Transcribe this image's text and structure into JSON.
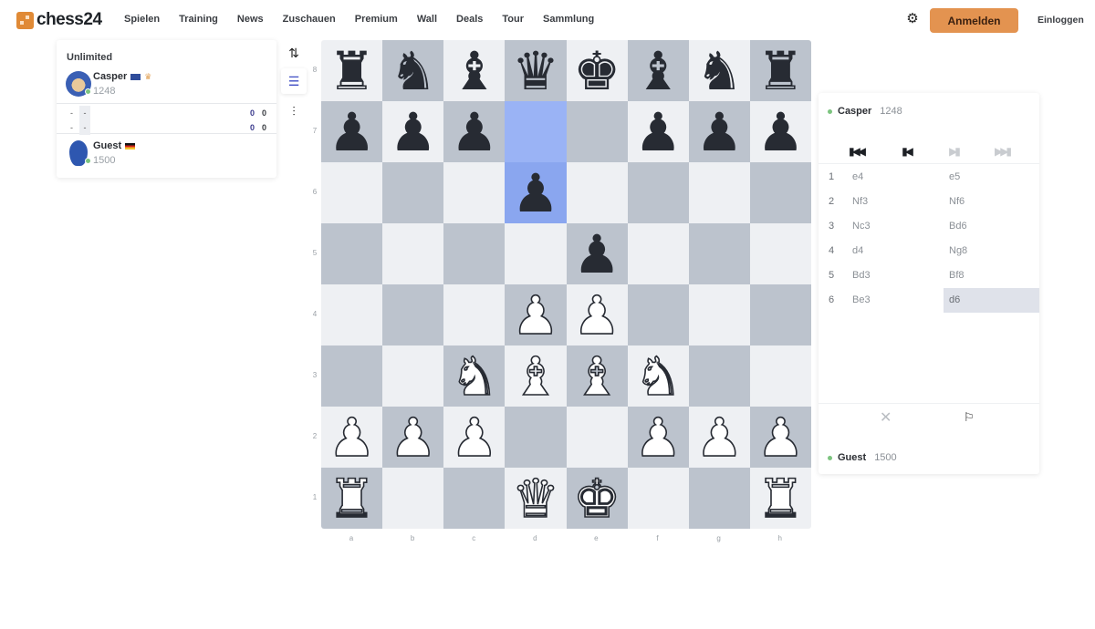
{
  "header": {
    "logo_text": "chess24",
    "nav": [
      "Spielen",
      "Training",
      "News",
      "Zuschauen",
      "Premium",
      "Wall",
      "Deals",
      "Tour",
      "Sammlung"
    ],
    "settings_icon": "gear-icon",
    "register_label": "Anmelden",
    "login_label": "Einloggen",
    "accent": "#e39350"
  },
  "game_panel": {
    "title": "Unlimited",
    "top_player": {
      "name": "Casper",
      "rating": "1248",
      "flag": "NZ",
      "badge": "crown",
      "online": true
    },
    "bottom_player": {
      "name": "Guest",
      "rating": "1500",
      "flag": "DE",
      "online": true
    },
    "score_rows": [
      {
        "c1": "-",
        "c2": "-",
        "s1": "0",
        "s2": "0"
      },
      {
        "c1": "-",
        "c2": "-",
        "s1": "0",
        "s2": "0"
      }
    ]
  },
  "tools": [
    "flip-board-icon",
    "move-list-icon",
    "settings-sliders-icon"
  ],
  "board": {
    "ranks": [
      "8",
      "7",
      "6",
      "5",
      "4",
      "3",
      "2",
      "1"
    ],
    "files": [
      "a",
      "b",
      "c",
      "d",
      "e",
      "f",
      "g",
      "h"
    ],
    "position": [
      [
        "r",
        "n",
        "b",
        "q",
        "k",
        "b",
        "n",
        "r"
      ],
      [
        "p",
        "p",
        "p",
        "",
        "",
        "p",
        "p",
        "p"
      ],
      [
        "",
        "",
        "",
        "p",
        "",
        "",
        "",
        ""
      ],
      [
        "",
        "",
        "",
        "",
        "p",
        "",
        "",
        ""
      ],
      [
        "",
        "",
        "",
        "P",
        "P",
        "",
        "",
        ""
      ],
      [
        "",
        "",
        "N",
        "B",
        "B",
        "N",
        "",
        ""
      ],
      [
        "P",
        "P",
        "P",
        "",
        "",
        "P",
        "P",
        "P"
      ],
      [
        "R",
        "",
        "",
        "Q",
        "K",
        "",
        "",
        "R"
      ]
    ],
    "last_move": {
      "from": "d7",
      "to": "d6"
    },
    "colors": {
      "light": "#eef0f3",
      "dark": "#bcc3cd",
      "highlight_from": "#9ab3f5",
      "highlight_to": "#8aa6ef"
    }
  },
  "move_panel": {
    "top_player": {
      "name": "Casper",
      "rating": "1248"
    },
    "bottom_player": {
      "name": "Guest",
      "rating": "1500"
    },
    "nav_buttons": [
      {
        "icon": "first-move-icon",
        "glyph": "⏮",
        "enabled": true
      },
      {
        "icon": "previous-move-icon",
        "glyph": "⏴",
        "enabled": true
      },
      {
        "icon": "next-move-icon",
        "glyph": "⏵",
        "enabled": false
      },
      {
        "icon": "last-move-icon",
        "glyph": "⏭",
        "enabled": false
      }
    ],
    "moves": [
      {
        "num": "1",
        "white": "e4",
        "black": "e5"
      },
      {
        "num": "2",
        "white": "Nf3",
        "black": "Nf6"
      },
      {
        "num": "3",
        "white": "Nc3",
        "black": "Bd6"
      },
      {
        "num": "4",
        "white": "d4",
        "black": "Ng8"
      },
      {
        "num": "5",
        "white": "Bd3",
        "black": "Bf8"
      },
      {
        "num": "6",
        "white": "Be3",
        "black": "d6"
      }
    ],
    "current_move_index": 5,
    "actions": {
      "abort": "close-icon",
      "resign": "flag-icon"
    }
  }
}
